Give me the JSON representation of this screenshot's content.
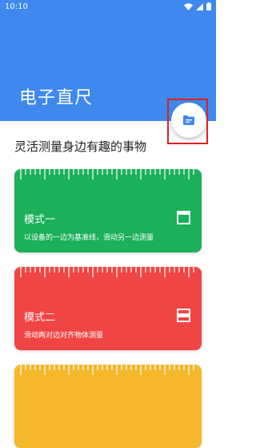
{
  "status": {
    "time": "10:10"
  },
  "header": {
    "title": "电子直尺"
  },
  "tagline": "灵活测量身边有趣的事物",
  "fab": {
    "icon": "folder-icon"
  },
  "colors": {
    "header": "#3e88ee",
    "card_green": "#1bb059",
    "card_red": "#f04545",
    "card_yellow": "#f5b82a"
  },
  "cards": [
    {
      "title": "模式一",
      "desc": "以设备的一边为基准线，滑动另一边测量",
      "icon": "top-bar-window-icon"
    },
    {
      "title": "模式二",
      "desc": "滑动两对边对齐物体测量",
      "icon": "middle-band-window-icon"
    }
  ]
}
